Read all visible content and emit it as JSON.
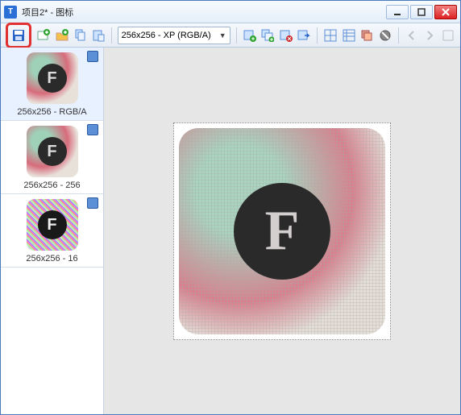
{
  "titlebar": {
    "app_glyph": "T",
    "title": "项目2* - 图标"
  },
  "toolbar": {
    "format_combo": "256x256 - XP (RGB/A)",
    "combo_arrow": "▼"
  },
  "sidebar": {
    "items": [
      {
        "label": "256x256 - RGB/A"
      },
      {
        "label": "256x256 - 256"
      },
      {
        "label": "256x256 - 16"
      }
    ]
  },
  "canvas": {
    "letter": "F"
  },
  "icons": {
    "save_color": "#2a64c8",
    "plus_color": "#2fa52f",
    "x_color": "#d02828"
  }
}
